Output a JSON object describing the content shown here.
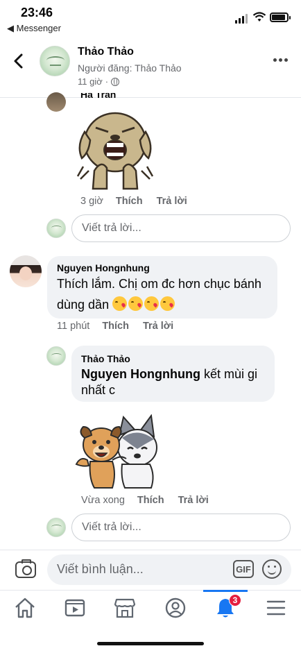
{
  "status_bar": {
    "time": "23:46",
    "back_app": "◀ Messenger"
  },
  "header": {
    "title": "Thảo Thảo",
    "subtitle": "Người đăng: Thảo Thảo",
    "time": "11 giờ"
  },
  "comments": [
    {
      "author": "Hà Trần",
      "time": "3 giờ",
      "like_label": "Thích",
      "reply_label": "Trả lời",
      "reply_placeholder": "Viết trả lời..."
    },
    {
      "author": "Nguyen Hongnhung",
      "text_line1": "Thích lắm. Chị om đc hơn chục bánh",
      "text_line2": "dùng dần",
      "time": "11 phút",
      "like_label": "Thích",
      "reply_label": "Trả lời"
    },
    {
      "author": "Thảo Thảo",
      "mention": "Nguyen Hongnhung",
      "text_after_mention": " kết mùi gi",
      "text_line2": "nhất c",
      "time": "Vừa xong",
      "like_label": "Thích",
      "reply_label": "Trả lời",
      "reply_placeholder": "Viết trả lời..."
    }
  ],
  "composer": {
    "placeholder": "Viết bình luận...",
    "gif_label": "GIF"
  },
  "tabbar": {
    "notifications_badge": "3"
  },
  "colors": {
    "accent": "#1877f2",
    "badge": "#e41e3f",
    "bubble": "#f0f2f5",
    "muted": "#65676b"
  }
}
